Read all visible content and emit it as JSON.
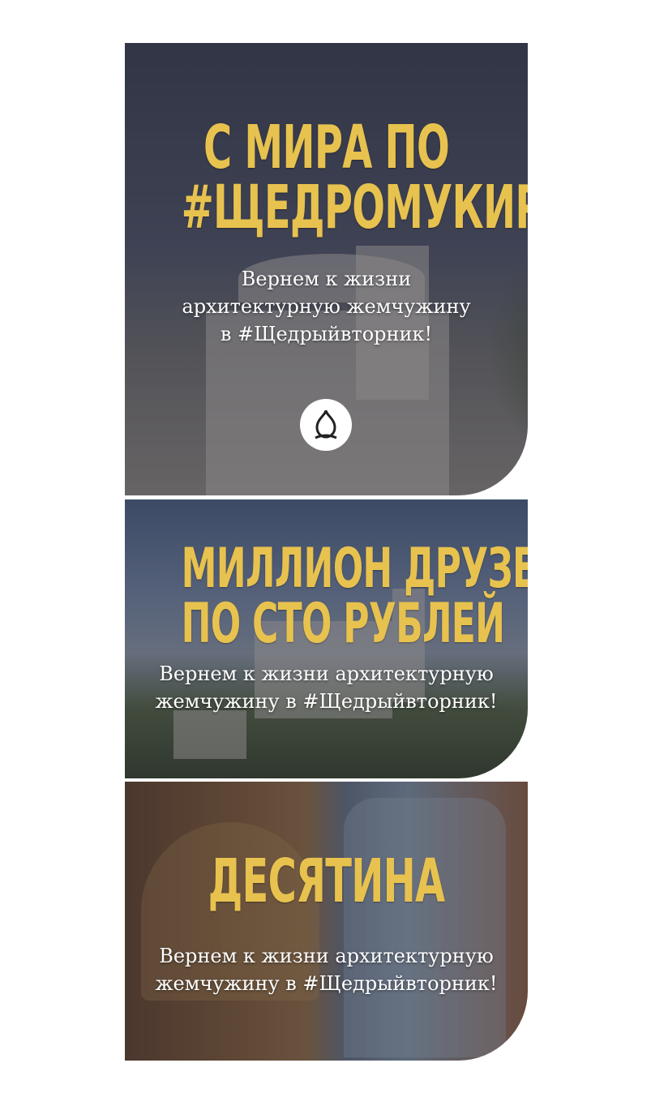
{
  "cards": [
    {
      "title_lines": [
        "С МИРА ПО",
        "#ЩЕДРОМУКИРПИЧУ"
      ],
      "subtitle_lines": [
        "Вернем к жизни",
        "архитектурную жемчужину",
        "в #Щедрыйвторник!"
      ],
      "logo": "dome-logo-icon"
    },
    {
      "title_lines": [
        "МИЛЛИОН ДРУЗЕЙ",
        "ПО СТО РУБЛЕЙ"
      ],
      "subtitle_lines": [
        "Вернем к жизни архитектурную",
        "жемчужину в #Щедрыйвторник!"
      ]
    },
    {
      "title_lines": [
        "ДЕСЯТИНА"
      ],
      "subtitle_lines": [
        "Вернем к жизни архитектурную",
        "жемчужину в #Щедрыйвторник!"
      ]
    }
  ],
  "colors": {
    "title": "#e8c24f",
    "subtitle": "#ffffff",
    "background": "#ffffff"
  }
}
